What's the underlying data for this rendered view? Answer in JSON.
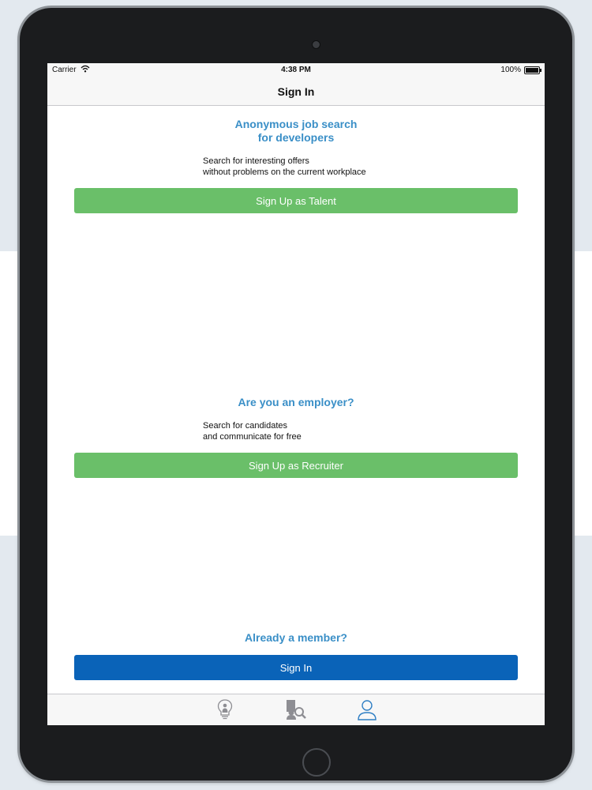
{
  "status_bar": {
    "carrier": "Carrier",
    "time": "4:38 PM",
    "battery": "100%",
    "battery_level": 1.0
  },
  "nav": {
    "title": "Sign In"
  },
  "talent_section": {
    "heading_line1": "Anonymous job search",
    "heading_line2": "for developers",
    "desc_line1": "Search for interesting offers",
    "desc_line2": "without problems on the current workplace",
    "button_label": "Sign Up as Talent"
  },
  "employer_section": {
    "heading": "Are you an employer?",
    "desc_line1": "Search for candidates",
    "desc_line2": "and communicate for free",
    "button_label": "Sign Up as Recruiter"
  },
  "member_section": {
    "heading": "Already a member?",
    "button_label": "Sign In"
  },
  "tab_bar": {
    "tabs": [
      {
        "icon": "lightbulb-person-icon",
        "active": false
      },
      {
        "icon": "search-candidates-icon",
        "active": false
      },
      {
        "icon": "profile-icon",
        "active": true
      }
    ]
  },
  "colors": {
    "heading": "#3a8fc7",
    "green_button": "#6abf69",
    "blue_button": "#0a63b8",
    "active_tab": "#2f7fc4",
    "inactive_tab": "#8e8e93"
  }
}
